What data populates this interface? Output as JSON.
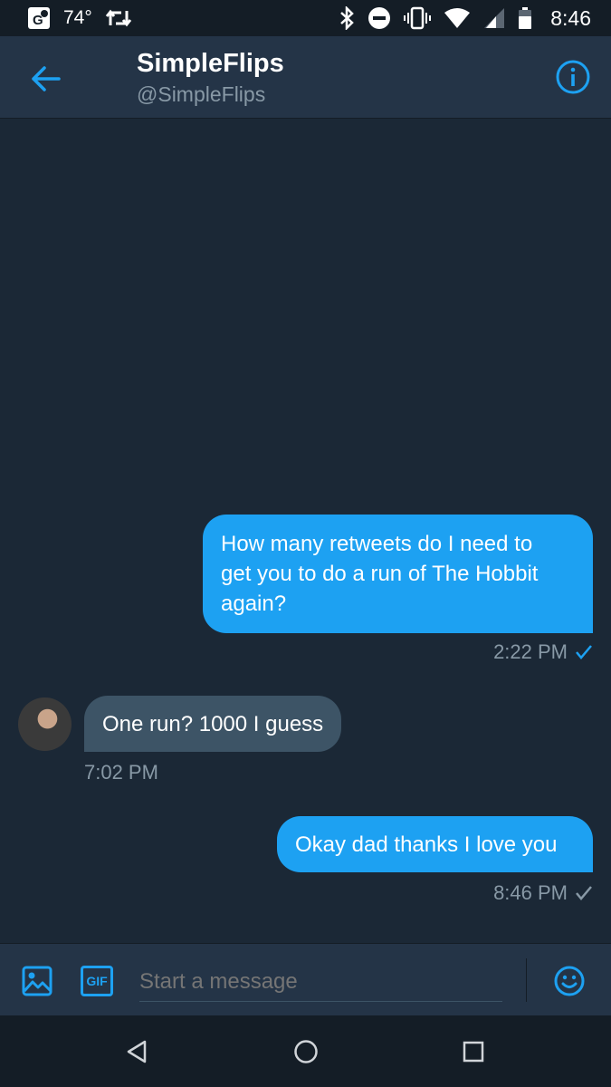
{
  "status_bar": {
    "temperature": "74°",
    "time": "8:46"
  },
  "header": {
    "name": "SimpleFlips",
    "handle": "@SimpleFlips"
  },
  "messages": [
    {
      "direction": "outgoing",
      "lines": [
        "How many retweets do I need to",
        "get you to do a run of The Hobbit",
        "again?"
      ],
      "time": "2:22 PM",
      "read": true
    },
    {
      "direction": "incoming",
      "text": "One run? 1000 I guess",
      "time": "7:02 PM"
    },
    {
      "direction": "outgoing",
      "text": "Okay dad thanks I love you",
      "time": "8:46 PM",
      "read": false
    }
  ],
  "composer": {
    "placeholder": "Start a message",
    "gif_label": "GIF"
  },
  "colors": {
    "accent": "#1da1f2",
    "background": "#1b2836",
    "header": "#243447",
    "incoming_bubble": "#3d5466",
    "muted_text": "#8899a6"
  }
}
